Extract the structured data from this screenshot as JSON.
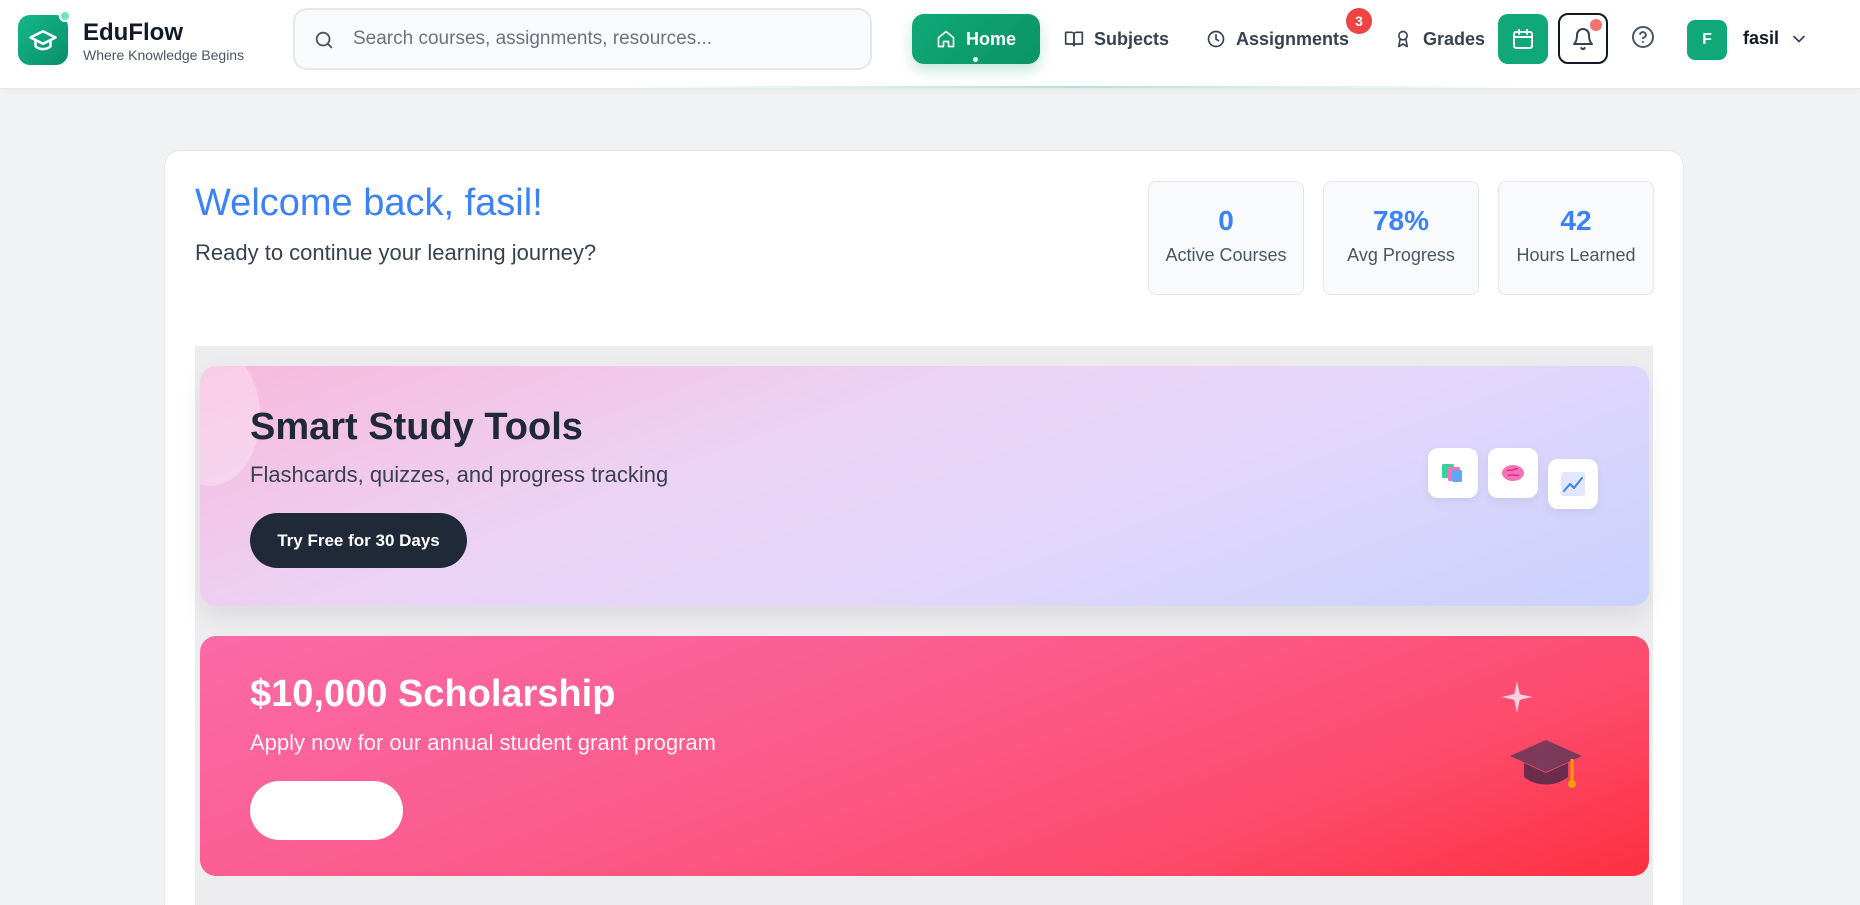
{
  "brand": {
    "name": "EduFlow",
    "tagline": "Where Knowledge Begins"
  },
  "search": {
    "placeholder": "Search courses, assignments, resources..."
  },
  "nav": {
    "home": "Home",
    "subjects": "Subjects",
    "assignments": "Assignments",
    "assignments_badge": "3",
    "grades": "Grades"
  },
  "user": {
    "initial": "F",
    "name": "fasil"
  },
  "welcome": {
    "title": "Welcome back, fasil!",
    "subtitle": "Ready to continue your learning journey?"
  },
  "stats": [
    {
      "value": "0",
      "label": "Active Courses"
    },
    {
      "value": "78%",
      "label": "Avg Progress"
    },
    {
      "value": "42",
      "label": "Hours Learned"
    }
  ],
  "promos": [
    {
      "title": "Smart Study Tools",
      "subtitle": "Flashcards, quizzes, and progress tracking",
      "button": "Try Free for 30 Days",
      "icons": [
        "flashcards-icon",
        "brain-icon",
        "chart-icon"
      ]
    },
    {
      "title": "$10,000 Scholarship",
      "subtitle": "Apply now for our annual student grant program",
      "button": "",
      "icons": [
        "sparkle-icon",
        "graduation-cap-icon"
      ]
    }
  ],
  "colors": {
    "brand_green": "#10a876",
    "accent_blue": "#3b82f6",
    "badge_red": "#ef4444",
    "dark_button": "#1f2937"
  }
}
